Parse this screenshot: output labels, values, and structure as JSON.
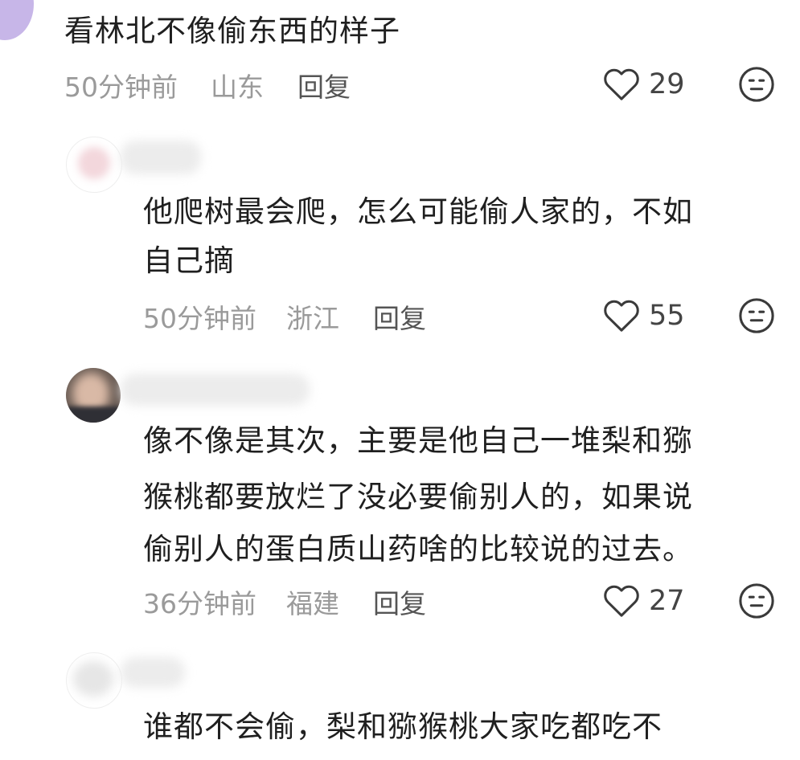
{
  "comments": [
    {
      "lines": [
        "看林北不像偷东西的样子"
      ],
      "time": "50分钟前",
      "location": "山东",
      "reply_label": "回复",
      "likes": "29"
    },
    {
      "lines": [
        "他爬树最会爬，怎么可能偷人家的，不如",
        "自己摘"
      ],
      "time": "50分钟前",
      "location": "浙江",
      "reply_label": "回复",
      "likes": "55"
    },
    {
      "lines": [
        "像不像是其次，主要是他自己一堆梨和猕",
        "猴桃都要放烂了没必要偷别人的，如果说",
        "偷别人的蛋白质山药啥的比较说的过去。"
      ],
      "time": "36分钟前",
      "location": "福建",
      "reply_label": "回复",
      "likes": "27"
    },
    {
      "lines": [
        "谁都不会偷，梨和猕猴桃大家吃都吃不"
      ]
    }
  ],
  "icons": {
    "like": "heart-outline-icon",
    "dislike": "neutral-face-icon"
  },
  "colors": {
    "text": "#1f1f1f",
    "meta": "#9a9a9a",
    "reply": "#555555",
    "icon": "#3a3a3a"
  }
}
